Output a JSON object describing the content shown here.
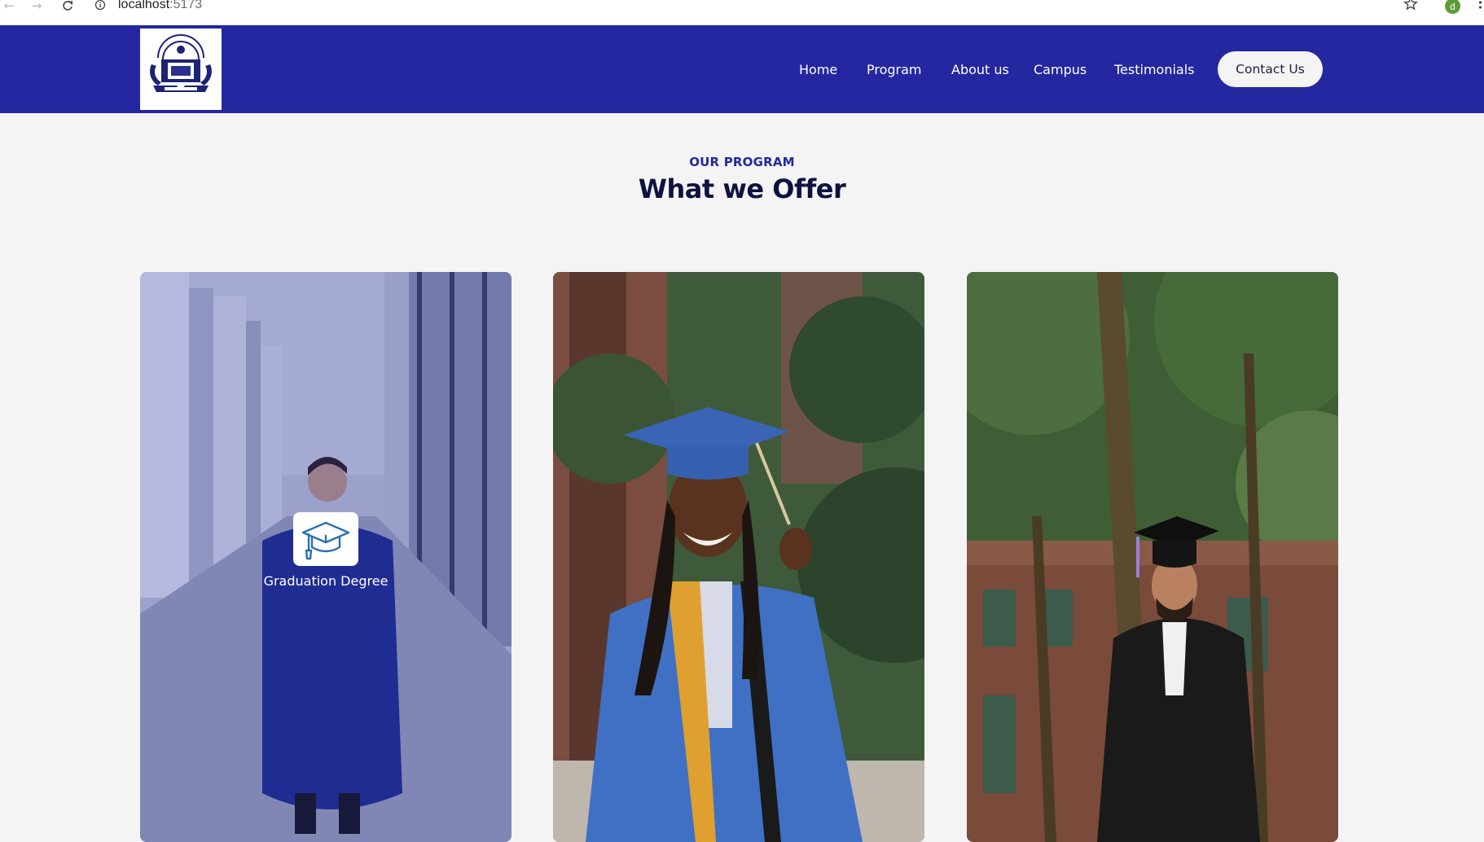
{
  "browser": {
    "url_host": "localhost",
    "url_port": ":5173",
    "profile_initial": "d"
  },
  "header": {
    "logo_alt": "school-logo",
    "nav": [
      {
        "label": "Home"
      },
      {
        "label": "Program"
      },
      {
        "label": "About us"
      },
      {
        "label": "Campus"
      },
      {
        "label": "Testimonials"
      }
    ],
    "contact_label": "Contact Us",
    "bg_color": "#24279f"
  },
  "program": {
    "eyebrow": "OUR PROGRAM",
    "title": "What we Offer",
    "cards": [
      {
        "caption": "Graduation Degree",
        "icon": "graduation-cap-icon"
      },
      {
        "caption": ""
      },
      {
        "caption": ""
      }
    ]
  }
}
